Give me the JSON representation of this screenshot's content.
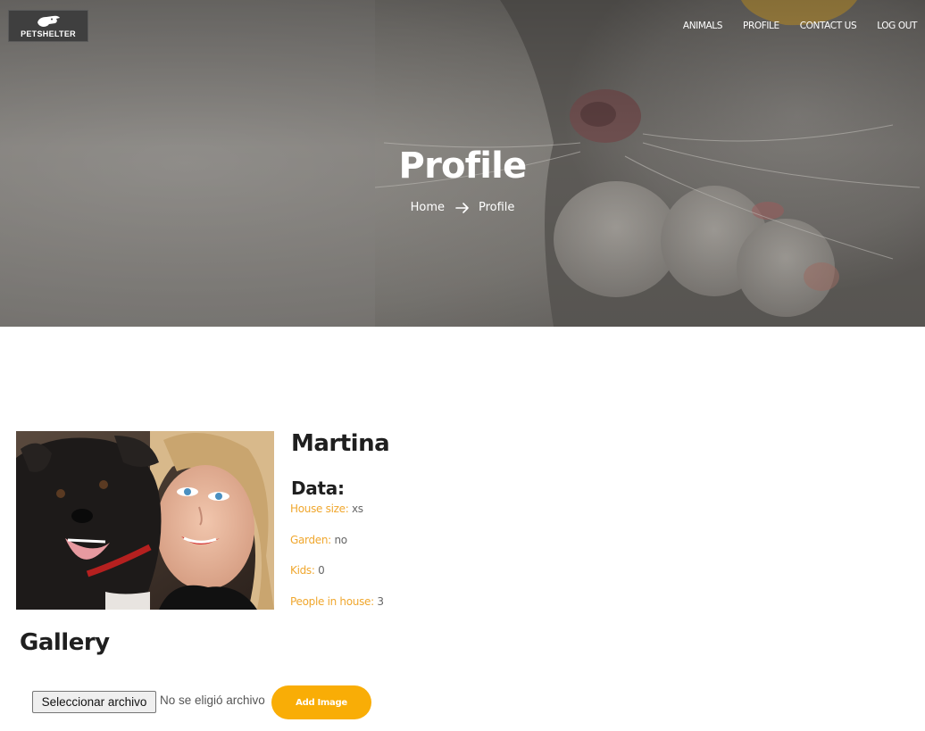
{
  "brand": {
    "logo_text": "PETSHELTER"
  },
  "nav": [
    {
      "label": "ANIMALS"
    },
    {
      "label": "PROFILE"
    },
    {
      "label": "CONTACT US"
    },
    {
      "label": "LOG OUT"
    }
  ],
  "hero": {
    "title": "Profile",
    "breadcrumb": {
      "home": "Home",
      "current": "Profile"
    }
  },
  "profile": {
    "name": "Martina",
    "data_title": "Data:",
    "fields": [
      {
        "label": "House size:",
        "value": "xs"
      },
      {
        "label": "Garden:",
        "value": "no"
      },
      {
        "label": "Kids:",
        "value": "0"
      },
      {
        "label": "People in house:",
        "value": "3"
      }
    ]
  },
  "gallery": {
    "title": "Gallery",
    "file_button_label": "Seleccionar archivo",
    "file_status": "No se eligió archivo",
    "add_button_label": "Add Image"
  },
  "colors": {
    "accent": "#f9ad06",
    "label_orange": "#f0a72e",
    "heading": "#1f1f1f",
    "value_grey": "#666666"
  },
  "icons": {
    "logo": "dog-head-icon",
    "breadcrumb_separator": "arrow-right-icon"
  }
}
